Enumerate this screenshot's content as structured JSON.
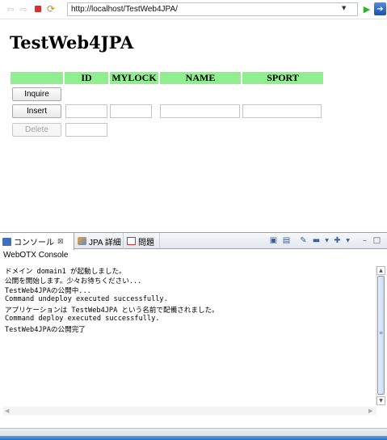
{
  "browser": {
    "url": "http://localhost/TestWeb4JPA/"
  },
  "page": {
    "title": "TestWeb4JPA",
    "columns": [
      "",
      "ID",
      "MYLOCK",
      "NAME",
      "SPORT"
    ],
    "buttons": {
      "inquire": "Inquire",
      "insert": "Insert",
      "delete": "Delete"
    }
  },
  "console": {
    "tabs": [
      {
        "label": "コンソール",
        "close": "⊠"
      },
      {
        "label": "JPA 詳細"
      },
      {
        "label": "問題"
      }
    ],
    "name": "WebOTX Console",
    "lines": [
      "ドメイン domain1 が起動しました。",
      "公開を開始します。少々お待ちください...",
      "TestWeb4JPAの公開中...",
      "Command undeploy executed successfully.",
      "アプリケーションは TestWeb4JPA という名前で配備されました。",
      "Command deploy executed successfully.",
      "TestWeb4JPAの公開完了"
    ]
  },
  "colors": {
    "header_bg": "#90ee90",
    "accent": "#2a6fc0"
  }
}
